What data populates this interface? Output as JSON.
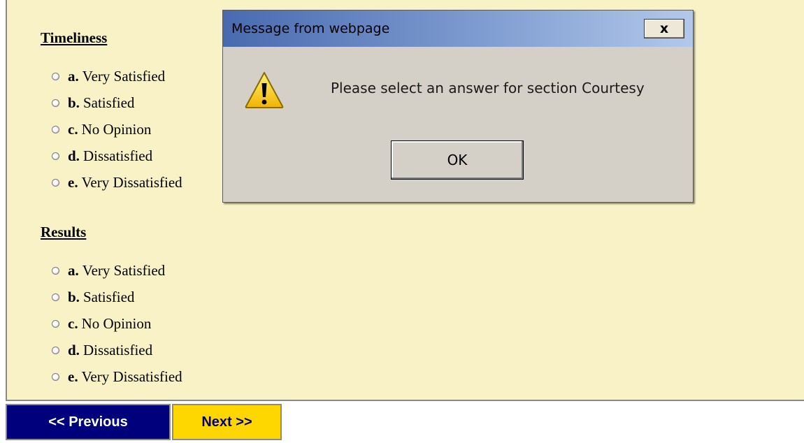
{
  "sections": [
    {
      "title": "Timeliness",
      "options": [
        {
          "letter": "a.",
          "text": "Very Satisfied"
        },
        {
          "letter": "b.",
          "text": "Satisfied"
        },
        {
          "letter": "c.",
          "text": "No Opinion"
        },
        {
          "letter": "d.",
          "text": "Dissatisfied"
        },
        {
          "letter": "e.",
          "text": "Very Dissatisfied"
        }
      ]
    },
    {
      "title": "Results",
      "options": [
        {
          "letter": "a.",
          "text": "Very Satisfied"
        },
        {
          "letter": "b.",
          "text": "Satisfied"
        },
        {
          "letter": "c.",
          "text": "No Opinion"
        },
        {
          "letter": "d.",
          "text": "Dissatisfied"
        },
        {
          "letter": "e.",
          "text": "Very Dissatisfied"
        }
      ]
    }
  ],
  "nav": {
    "previous_label": "<< Previous",
    "next_label": "Next >>"
  },
  "dialog": {
    "title": "Message from webpage",
    "close_label": "x",
    "icon": "warning-icon",
    "message": "Please select an answer for section Courtesy",
    "ok_label": "OK"
  },
  "colors": {
    "panel_background": "#f8f2c6",
    "previous_button": "#00007c",
    "next_button": "#ffd700",
    "dialog_background": "#d4d0c8"
  }
}
